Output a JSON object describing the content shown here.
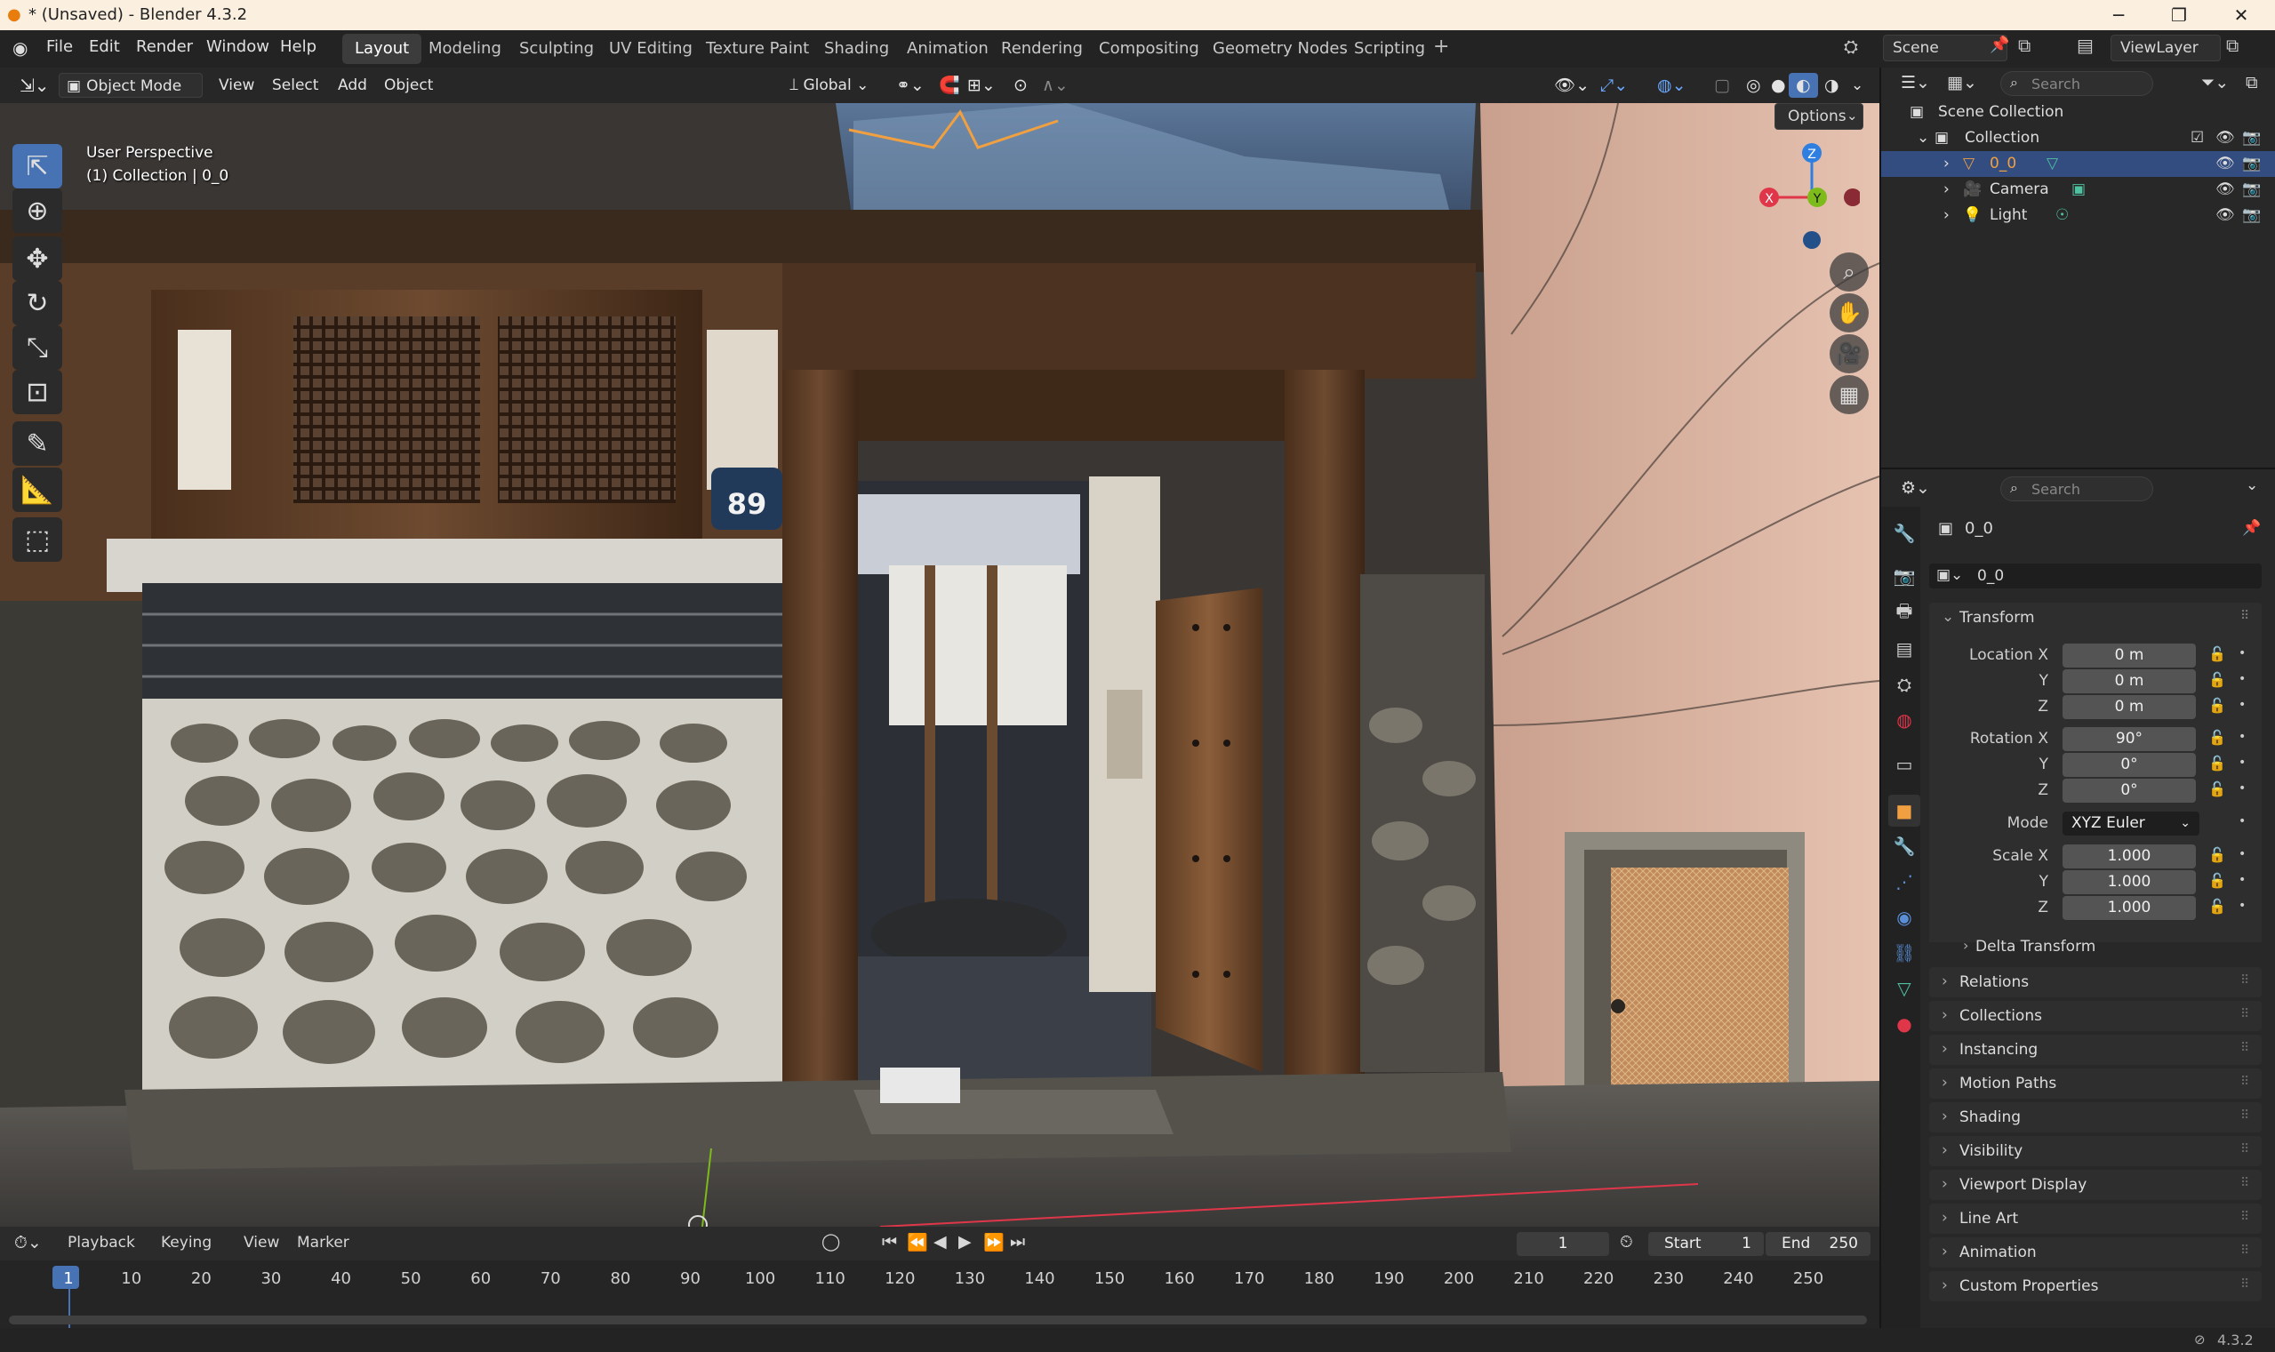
{
  "window": {
    "title": "* (Unsaved) - Blender 4.3.2"
  },
  "menu": [
    "File",
    "Edit",
    "Render",
    "Window",
    "Help"
  ],
  "workspaces": [
    "Layout",
    "Modeling",
    "Sculpting",
    "UV Editing",
    "Texture Paint",
    "Shading",
    "Animation",
    "Rendering",
    "Compositing",
    "Geometry Nodes",
    "Scripting"
  ],
  "active_workspace": "Layout",
  "scene": {
    "name": "Scene",
    "view_layer": "ViewLayer"
  },
  "viewport": {
    "mode": "Object Mode",
    "menus": [
      "View",
      "Select",
      "Add",
      "Object"
    ],
    "orientation": "Global",
    "options_label": "Options",
    "overlay_title": "User Perspective",
    "overlay_sub": "(1) Collection | 0_0",
    "gizmo": {
      "x": "X",
      "y": "Y",
      "z": "Z"
    },
    "house_number": "89"
  },
  "outliner": {
    "search_placeholder": "Search",
    "scene_collection": "Scene Collection",
    "collection": "Collection",
    "items": [
      {
        "label": "0_0",
        "selected": true
      },
      {
        "label": "Camera",
        "selected": false
      },
      {
        "label": "Light",
        "selected": false
      }
    ]
  },
  "properties": {
    "search_placeholder": "Search",
    "object_name": "0_0",
    "datablock_name": "0_0",
    "transform_header": "Transform",
    "location": {
      "label": "Location X",
      "x": "0 m",
      "y": "0 m",
      "z": "0 m"
    },
    "rotation": {
      "label": "Rotation X",
      "x": "90°",
      "y": "0°",
      "z": "0°"
    },
    "mode": {
      "label": "Mode",
      "value": "XYZ Euler"
    },
    "scale": {
      "label": "Scale X",
      "x": "1.000",
      "y": "1.000",
      "z": "1.000"
    },
    "axis_labels": {
      "y": "Y",
      "z": "Z"
    },
    "delta": "Delta Transform",
    "panels": [
      "Relations",
      "Collections",
      "Instancing",
      "Motion Paths",
      "Shading",
      "Visibility",
      "Viewport Display",
      "Line Art",
      "Animation",
      "Custom Properties"
    ]
  },
  "timeline": {
    "menus": [
      "Playback",
      "Keying",
      "View",
      "Marker"
    ],
    "current_frame": "1",
    "start_label": "Start",
    "start": "1",
    "end_label": "End",
    "end": "250",
    "ticks": [
      "1",
      "10",
      "20",
      "30",
      "40",
      "50",
      "60",
      "70",
      "80",
      "90",
      "100",
      "110",
      "120",
      "130",
      "140",
      "150",
      "160",
      "170",
      "180",
      "190",
      "200",
      "210",
      "220",
      "230",
      "240",
      "250"
    ]
  },
  "status": {
    "version": "4.3.2"
  },
  "colors": {
    "accent": "#4772b3",
    "selected_row": "#334d80",
    "orange_outline": "#f0a040",
    "x_axis": "#e0364a",
    "y_axis": "#7dbb1a",
    "z_axis": "#2f7fe0"
  }
}
